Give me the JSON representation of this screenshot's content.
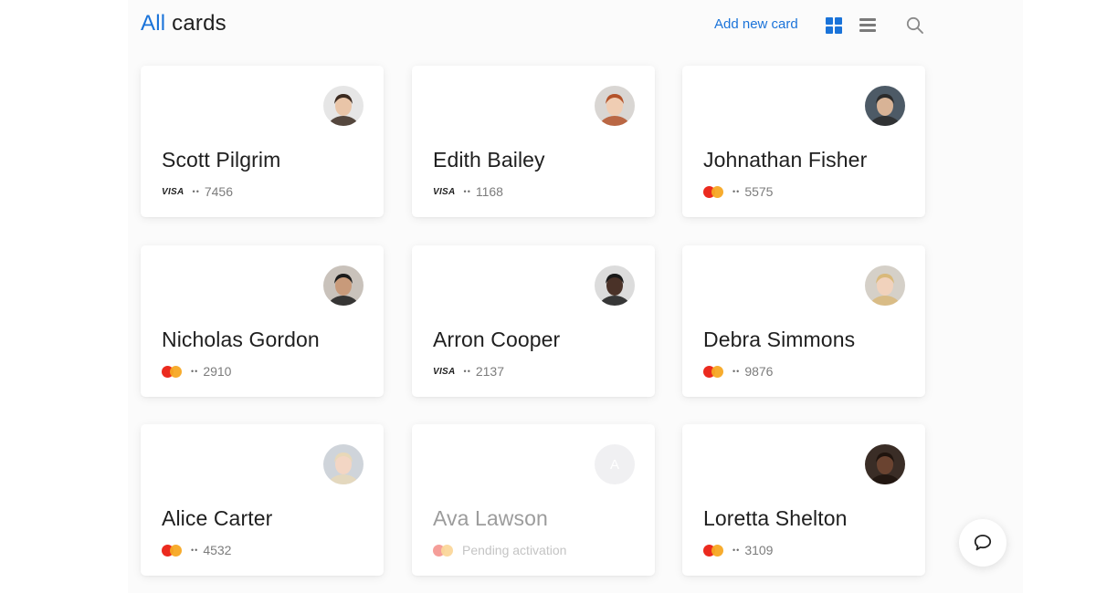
{
  "header": {
    "title_accent": "All",
    "title_rest": "cards",
    "add_label": "Add new card",
    "accent_color": "#1a73d9",
    "view_grid_icon": "grid-view-icon",
    "view_list_icon": "list-view-icon",
    "search_icon": "search-icon"
  },
  "cards": [
    {
      "name": "Scott Pilgrim",
      "brand": "visa",
      "brand_label": "VISA",
      "dots": "••",
      "last4": "7456",
      "avatar": "photo"
    },
    {
      "name": "Edith Bailey",
      "brand": "visa",
      "brand_label": "VISA",
      "dots": "••",
      "last4": "1168",
      "avatar": "photo"
    },
    {
      "name": "Johnathan Fisher",
      "brand": "mastercard",
      "dots": "••",
      "last4": "5575",
      "avatar": "photo"
    },
    {
      "name": "Nicholas Gordon",
      "brand": "mastercard",
      "dots": "••",
      "last4": "2910",
      "avatar": "photo"
    },
    {
      "name": "Arron Cooper",
      "brand": "visa",
      "brand_label": "VISA",
      "dots": "••",
      "last4": "2137",
      "avatar": "photo"
    },
    {
      "name": "Debra Simmons",
      "brand": "mastercard",
      "dots": "••",
      "last4": "9876",
      "avatar": "photo"
    },
    {
      "name": "Alice Carter",
      "brand": "mastercard",
      "dots": "••",
      "last4": "4532",
      "avatar": "photo"
    },
    {
      "name": "Ava Lawson",
      "brand": "mastercard",
      "status": "Pending activation",
      "avatar": "placeholder",
      "initial": "A"
    },
    {
      "name": "Loretta Shelton",
      "brand": "mastercard",
      "dots": "••",
      "last4": "3109",
      "avatar": "photo"
    }
  ],
  "chat": {
    "icon": "chat-bubble-icon"
  }
}
